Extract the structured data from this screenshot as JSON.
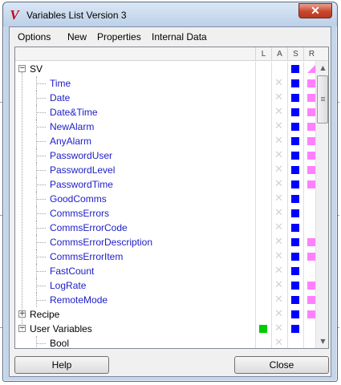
{
  "window": {
    "title": "Variables List Version 3",
    "close_glyph": "✕"
  },
  "menu": {
    "items": [
      "Options",
      "New",
      "Properties",
      "Internal Data"
    ]
  },
  "columns": [
    "L",
    "A",
    "S",
    "R"
  ],
  "tree": [
    {
      "label": "SV",
      "indent": 0,
      "color": "black",
      "expander": "−",
      "L": "",
      "A": "",
      "S": "blue",
      "R": "tri"
    },
    {
      "label": "Time",
      "indent": 1,
      "color": "blue",
      "L": "",
      "A": "x",
      "S": "blue",
      "R": "pink"
    },
    {
      "label": "Date",
      "indent": 1,
      "color": "blue",
      "L": "",
      "A": "x",
      "S": "blue",
      "R": "pink"
    },
    {
      "label": "Date&Time",
      "indent": 1,
      "color": "blue",
      "L": "",
      "A": "x",
      "S": "blue",
      "R": "pink"
    },
    {
      "label": "NewAlarm",
      "indent": 1,
      "color": "blue",
      "L": "",
      "A": "x",
      "S": "blue",
      "R": "pink"
    },
    {
      "label": "AnyAlarm",
      "indent": 1,
      "color": "blue",
      "L": "",
      "A": "x",
      "S": "blue",
      "R": "pink"
    },
    {
      "label": "PasswordUser",
      "indent": 1,
      "color": "blue",
      "L": "",
      "A": "x",
      "S": "blue",
      "R": "pink"
    },
    {
      "label": "PasswordLevel",
      "indent": 1,
      "color": "blue",
      "L": "",
      "A": "x",
      "S": "blue",
      "R": "pink"
    },
    {
      "label": "PasswordTime",
      "indent": 1,
      "color": "blue",
      "L": "",
      "A": "x",
      "S": "blue",
      "R": "pink"
    },
    {
      "label": "GoodComms",
      "indent": 1,
      "color": "blue",
      "L": "",
      "A": "x",
      "S": "blue",
      "R": ""
    },
    {
      "label": "CommsErrors",
      "indent": 1,
      "color": "blue",
      "L": "",
      "A": "x",
      "S": "blue",
      "R": ""
    },
    {
      "label": "CommsErrorCode",
      "indent": 1,
      "color": "blue",
      "L": "",
      "A": "x",
      "S": "blue",
      "R": ""
    },
    {
      "label": "CommsErrorDescription",
      "indent": 1,
      "color": "blue",
      "L": "",
      "A": "x",
      "S": "blue",
      "R": "pink"
    },
    {
      "label": "CommsErrorItem",
      "indent": 1,
      "color": "blue",
      "L": "",
      "A": "x",
      "S": "blue",
      "R": "pink"
    },
    {
      "label": "FastCount",
      "indent": 1,
      "color": "blue",
      "L": "",
      "A": "x",
      "S": "blue",
      "R": ""
    },
    {
      "label": "LogRate",
      "indent": 1,
      "color": "blue",
      "L": "",
      "A": "x",
      "S": "blue",
      "R": "pink"
    },
    {
      "label": "RemoteMode",
      "indent": 1,
      "color": "blue",
      "L": "",
      "A": "x",
      "S": "blue",
      "R": "pink"
    },
    {
      "label": "Recipe",
      "indent": 0,
      "color": "black",
      "expander": "+",
      "L": "",
      "A": "x",
      "S": "blue",
      "R": "pink"
    },
    {
      "label": "User Variables",
      "indent": 0,
      "color": "black",
      "expander": "−",
      "L": "green",
      "A": "x",
      "S": "blue",
      "R": ""
    },
    {
      "label": "Bool",
      "indent": 1,
      "color": "black",
      "L": "",
      "A": "x",
      "S": "",
      "R": ""
    }
  ],
  "buttons": {
    "help": "Help",
    "close": "Close"
  },
  "colors": {
    "blue_square": "#0000ff",
    "pink_square": "#ff80ff",
    "green_square": "#00cc00",
    "item_text": "#1c1cc8"
  },
  "icons": {
    "app": "v-logo-icon",
    "scroll_up": "arrow-up-icon",
    "scroll_down": "arrow-down-icon"
  }
}
